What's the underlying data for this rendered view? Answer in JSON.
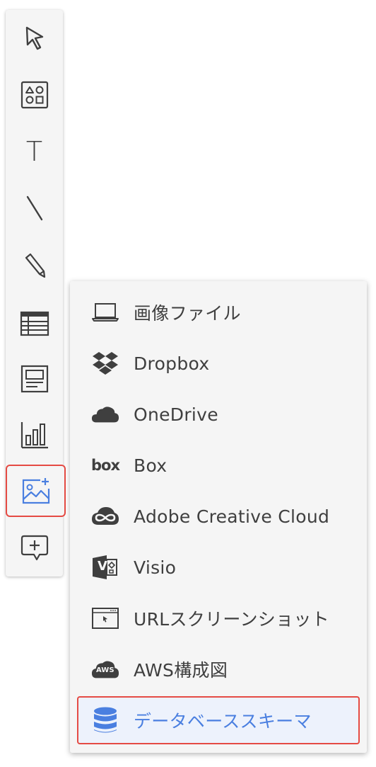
{
  "toolbar": {
    "tools": [
      {
        "name": "select",
        "icon": "cursor-arrow-icon"
      },
      {
        "name": "shapes",
        "icon": "shapes-icon"
      },
      {
        "name": "text",
        "icon": "text-t-icon",
        "glyph": "T"
      },
      {
        "name": "line",
        "icon": "line-icon"
      },
      {
        "name": "pen",
        "icon": "pencil-icon"
      },
      {
        "name": "table",
        "icon": "table-icon"
      },
      {
        "name": "card",
        "icon": "card-icon"
      },
      {
        "name": "chart",
        "icon": "bar-chart-icon"
      },
      {
        "name": "insert-image",
        "icon": "image-plus-icon",
        "selected": true
      },
      {
        "name": "comment",
        "icon": "comment-plus-icon"
      }
    ]
  },
  "menu": {
    "items": [
      {
        "label": "画像ファイル",
        "icon": "laptop-icon"
      },
      {
        "label": "Dropbox",
        "icon": "dropbox-icon"
      },
      {
        "label": "OneDrive",
        "icon": "onedrive-cloud-icon"
      },
      {
        "label": "Box",
        "icon": "box-logo-icon",
        "logo_text": "box"
      },
      {
        "label": "Adobe Creative Cloud",
        "icon": "adobe-cc-icon"
      },
      {
        "label": "Visio",
        "icon": "visio-icon",
        "logo_text": "V"
      },
      {
        "label": "URLスクリーンショット",
        "icon": "browser-window-icon"
      },
      {
        "label": "AWS構成図",
        "icon": "aws-cloud-icon",
        "logo_text": "AWS"
      },
      {
        "label": "データベーススキーマ",
        "icon": "database-icon",
        "selected": true
      }
    ]
  },
  "colors": {
    "accent_blue": "#4a7fe0",
    "highlight_red": "#e54b44",
    "icon_gray": "#3f3f3f",
    "panel_bg": "#f5f5f5",
    "selected_bg": "#edf2fc"
  }
}
